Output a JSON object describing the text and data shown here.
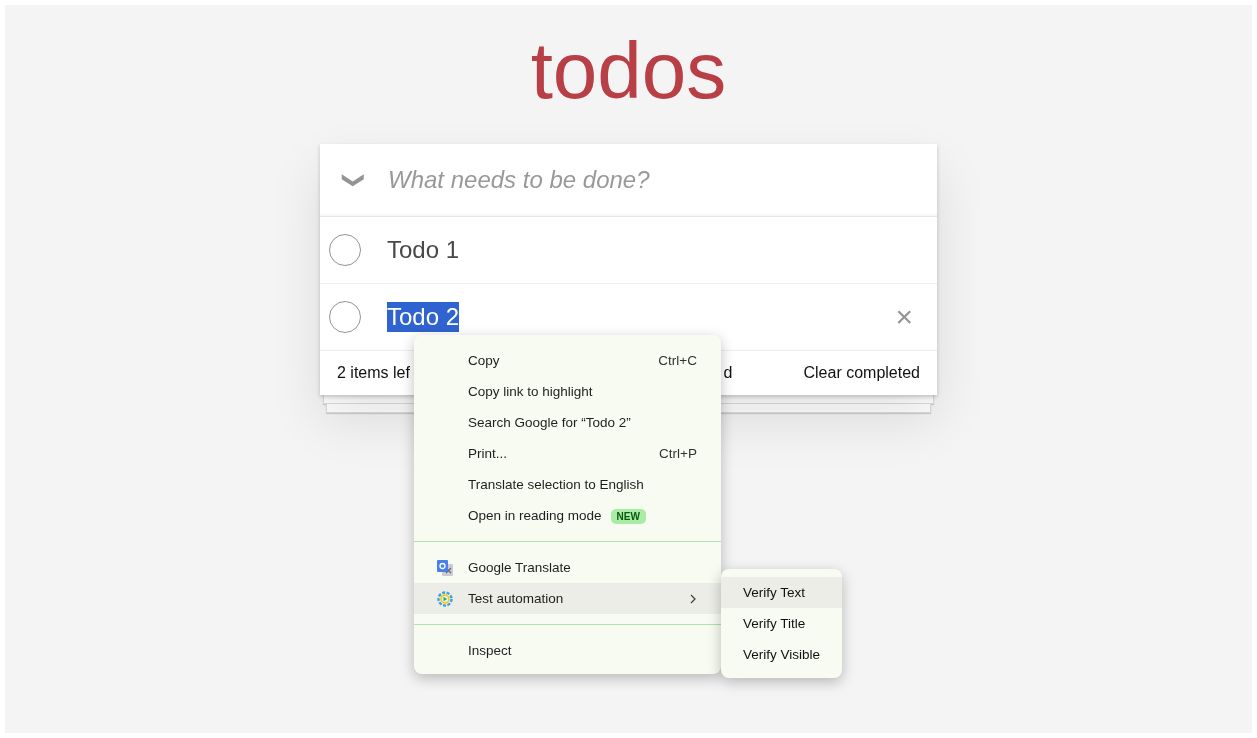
{
  "title": "todos",
  "new_todo": {
    "placeholder": "What needs to be done?",
    "toggle_all": "❯"
  },
  "todos": [
    {
      "label": "Todo 1",
      "completed": false,
      "text_selected": false
    },
    {
      "label": "Todo 2",
      "completed": false,
      "text_selected": true,
      "delete": "×"
    }
  ],
  "footer": {
    "count": "2 items lef",
    "filter_fragment": "d",
    "clear": "Clear completed"
  },
  "context_menu": {
    "items": [
      {
        "kind": "plain",
        "label": "Copy",
        "shortcut": "Ctrl+C",
        "highlighted": false
      },
      {
        "kind": "plain",
        "label": "Copy link to highlight",
        "highlighted": false
      },
      {
        "kind": "plain",
        "label": "Search Google for “Todo 2”",
        "highlighted": false
      },
      {
        "kind": "plain",
        "label": "Print...",
        "shortcut": "Ctrl+P",
        "highlighted": false
      },
      {
        "kind": "plain",
        "label": "Translate selection to English",
        "highlighted": false
      },
      {
        "kind": "plain",
        "label": "Open in reading mode",
        "badge": "NEW",
        "highlighted": false
      },
      {
        "kind": "separator"
      },
      {
        "kind": "translate",
        "label": "Google Translate",
        "highlighted": false
      },
      {
        "kind": "automation",
        "label": "Test automation",
        "submenu": true,
        "highlighted": true
      },
      {
        "kind": "separator"
      },
      {
        "kind": "plain",
        "label": "Inspect",
        "highlighted": false
      }
    ],
    "submenu": [
      {
        "label": "Verify Text",
        "highlighted": true
      },
      {
        "label": "Verify Title",
        "highlighted": false
      },
      {
        "label": "Verify Visible",
        "highlighted": false
      }
    ]
  }
}
